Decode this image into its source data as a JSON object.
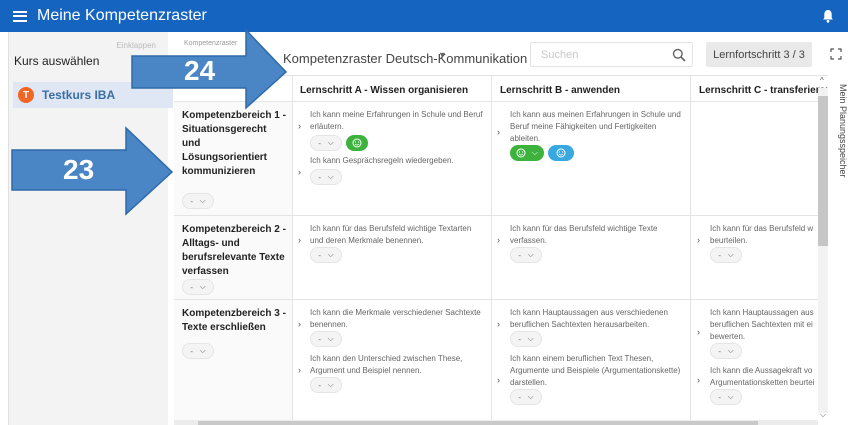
{
  "header": {
    "title": "Meine Kompetenzraster",
    "menu_icon": "hamburger-menu-icon",
    "bell_icon": "bell-icon",
    "bg_color": "#1565c0"
  },
  "sidebar": {
    "top_label": "Einklappen",
    "select_course_label": "Kurs auswählen",
    "course": {
      "avatar_letter": "T",
      "name": "Testkurs IBA",
      "avatar_color": "#f26522"
    }
  },
  "toolbar": {
    "top_label": "Kompetenzraster",
    "grid_title": "Kompetenzraster Deutsch-Kommunikation",
    "search_placeholder": "Suchen",
    "progress_label": "Lernfortschritt 3 / 3",
    "expand_icon": "fullscreen-icon"
  },
  "side_tab": "Mein Planungsspeicher",
  "grid": {
    "columns": [
      "Lernschritt A - Wissen organisieren",
      "Lernschritt B - anwenden",
      "Lernschritt C - transferieren"
    ],
    "rows": [
      {
        "title": "Kompetenzbereich 1 - Situationsgerecht und Lösungsorientiert kommunizieren",
        "row_dropdown": "-",
        "cells": [
          [
            {
              "text": "Ich kann meine Erfahrungen in Schule und Beruf erläutern.",
              "dd": "-",
              "rating": "green-smiley"
            },
            {
              "text": "Ich kann Gesprächsregeln wiedergeben.",
              "dd": "-"
            }
          ],
          [
            {
              "text": "Ich kann aus meinen Erfahrungen in Schule und Beruf meine Fähigkeiten und Fertigkeiten ableiten.",
              "rating_dd": "green-smiley",
              "rating2": "blue-smiley"
            }
          ],
          []
        ]
      },
      {
        "title": "Kompetenzbereich 2 - Alltags- und berufsrelevante Texte verfassen",
        "row_dropdown": "-",
        "cells": [
          [
            {
              "text": "Ich kann für das Berufsfeld wichtige Textarten und deren Merkmale benennen.",
              "dd": "-"
            }
          ],
          [
            {
              "text": "Ich kann für das Berufsfeld wichtige Texte verfassen.",
              "dd": "-"
            }
          ],
          [
            {
              "text": "Ich kann für das Berufsfeld w beurteilen.",
              "dd": "-"
            }
          ]
        ]
      },
      {
        "title": "Kompetenzbereich 3 - Texte erschließen",
        "row_dropdown": "-",
        "cells": [
          [
            {
              "text": "Ich kann die Merkmale verschiedener Sachtexte benennen.",
              "dd": "-"
            },
            {
              "text": "Ich kann den Unterschied zwischen These, Argument und Beispiel nennen.",
              "dd": "-"
            }
          ],
          [
            {
              "text": "Ich kann Hauptaussagen aus verschiedenen beruflichen Sachtexten herausarbeiten.",
              "dd": "-"
            },
            {
              "text": "Ich kann einem beruflichen Text Thesen, Argumente und Beispiele (Argumentationskette) darstellen.",
              "dd": "-"
            }
          ],
          [
            {
              "text": "Ich kann Hauptaussagen aus beruflichen Sachtexten mit ei bewerten.",
              "dd": "-"
            },
            {
              "text": "Ich kann die Aussagekraft vo Argumentationsketten beurtei",
              "dd": "-"
            }
          ]
        ]
      }
    ]
  },
  "annotations": [
    {
      "label": "24",
      "color": "#4a86c5"
    },
    {
      "label": "23",
      "color": "#4a86c5"
    }
  ]
}
